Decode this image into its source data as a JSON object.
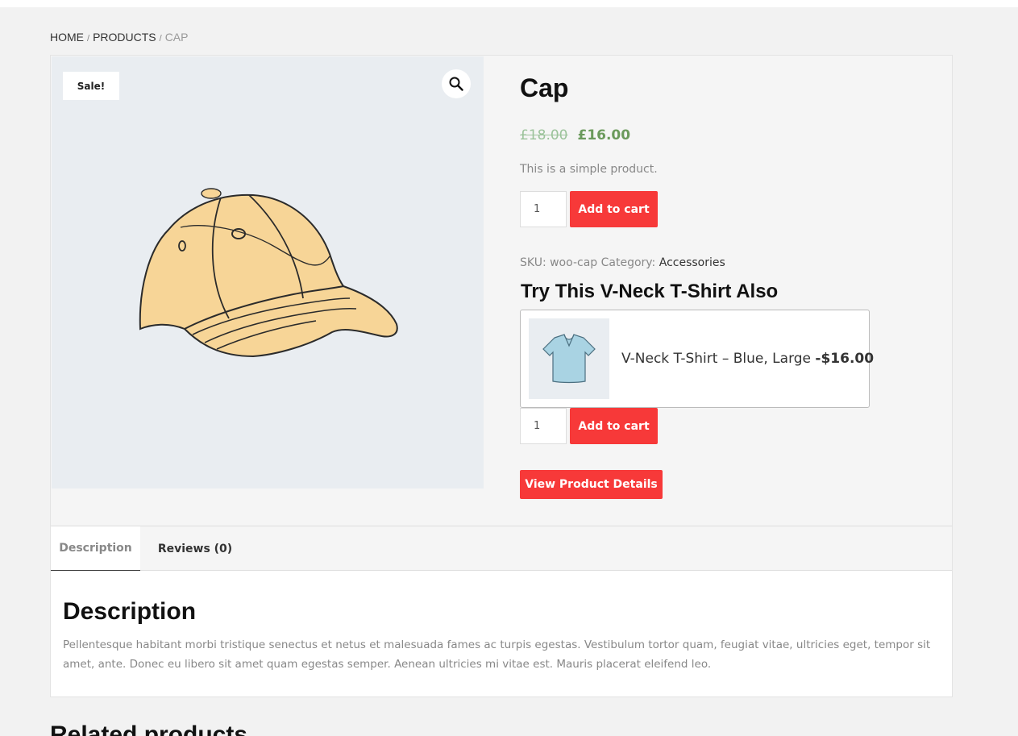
{
  "breadcrumb": {
    "home": "HOME",
    "products": "PRODUCTS",
    "current": "CAP",
    "separator": "/"
  },
  "gallery": {
    "sale_badge": "Sale!",
    "zoom_icon": "search-icon"
  },
  "product": {
    "title": "Cap",
    "old_price": "£18.00",
    "new_price": "£16.00",
    "short_description": "This is a simple product.",
    "quantity": "1",
    "add_to_cart": "Add to cart",
    "sku_label": "SKU:",
    "sku_value": "woo-cap",
    "category_label": "Category:",
    "category_value": "Accessories"
  },
  "upsell": {
    "title": "Try This V-Neck T-Shirt Also",
    "item_name": "V-Neck T-Shirt – Blue, Large",
    "item_price": "-$16.00",
    "quantity": "1",
    "add_to_cart": "Add to cart",
    "view_details": "View Product Details"
  },
  "tabs": [
    {
      "label": "Description"
    },
    {
      "label": "Reviews (0)"
    }
  ],
  "description": {
    "heading": "Description",
    "body": "Pellentesque habitant morbi tristique senectus et netus et malesuada fames ac turpis egestas. Vestibulum tortor quam, feugiat vitae, ultricies eget, tempor sit amet, ante. Donec eu libero sit amet quam egestas semper. Aenean ultricies mi vitae est. Mauris placerat eleifend leo."
  },
  "related": {
    "heading": "Related products"
  },
  "colors": {
    "accent_red": "#f73939",
    "price_green": "#6b9a5c",
    "gallery_bg": "#e9edf1"
  }
}
